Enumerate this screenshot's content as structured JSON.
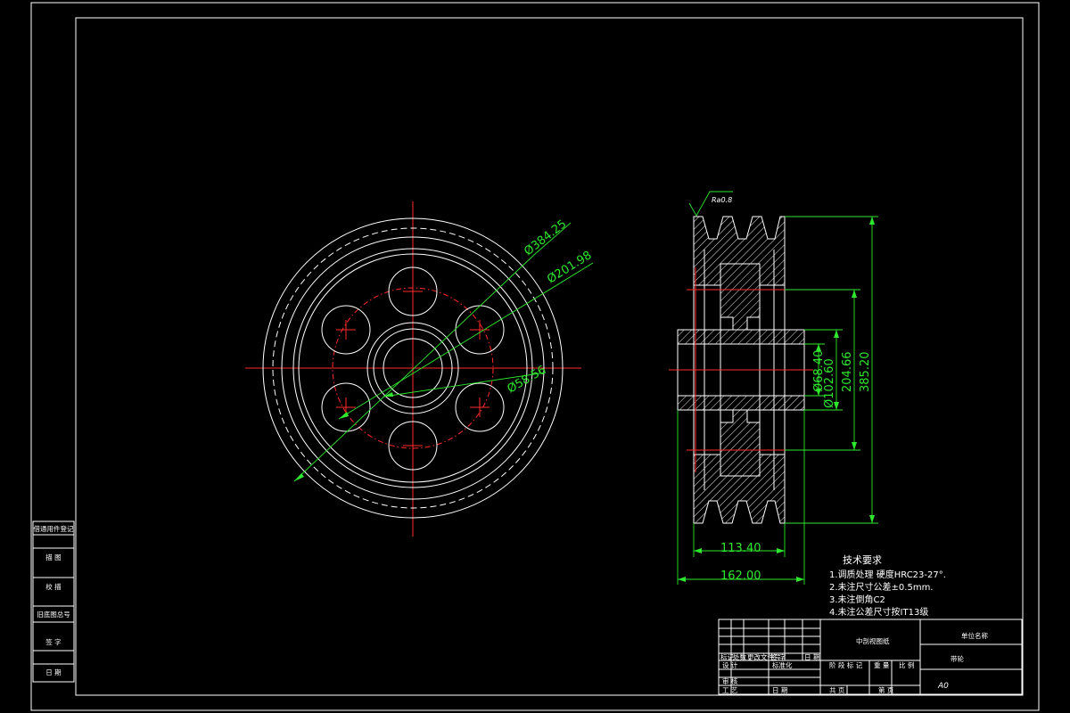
{
  "front_view": {
    "dimensions": {
      "d_outer": "Ø384.25",
      "d_mid": "Ø201.98",
      "d_hub": "Ø58.56"
    }
  },
  "side_view": {
    "roughness": "Ra0.8",
    "dimensions": {
      "d_bore": "Ø68.40",
      "d_hub": "Ø102.60",
      "h_mid": "204.66",
      "h_outer": "385.20",
      "w_rim": "113.40",
      "w_total": "162.00"
    }
  },
  "tech_requirements": {
    "title": "技术要求",
    "items": [
      "1.调质处理  硬度HRC23-27°.",
      "2.未注尺寸公差±0.5mm.",
      "3.未注倒角C2",
      "4.未注公差尺寸按IT13级"
    ]
  },
  "left_stamp": {
    "rows": [
      "借通用件登记",
      "描 图",
      "校 描",
      "旧底图总号",
      "签 字",
      "日 期"
    ]
  },
  "title_block": {
    "material": "中剖视图纸",
    "company": "单位名称",
    "part_name": "带轮",
    "sheet_size": "A0",
    "labels": {
      "mark": "标记",
      "count": "处数",
      "zone": "更改文件号",
      "sign": "签 字",
      "date": "日 期",
      "design": "设 计",
      "standard": "标准化",
      "check": "审 核",
      "process": "工 艺",
      "approve": "日 期",
      "stage": "阶 段 标 记",
      "weight": "重 量",
      "scale": "比 例",
      "sheets_total": "共   页",
      "sheet_no": "第   页"
    }
  }
}
